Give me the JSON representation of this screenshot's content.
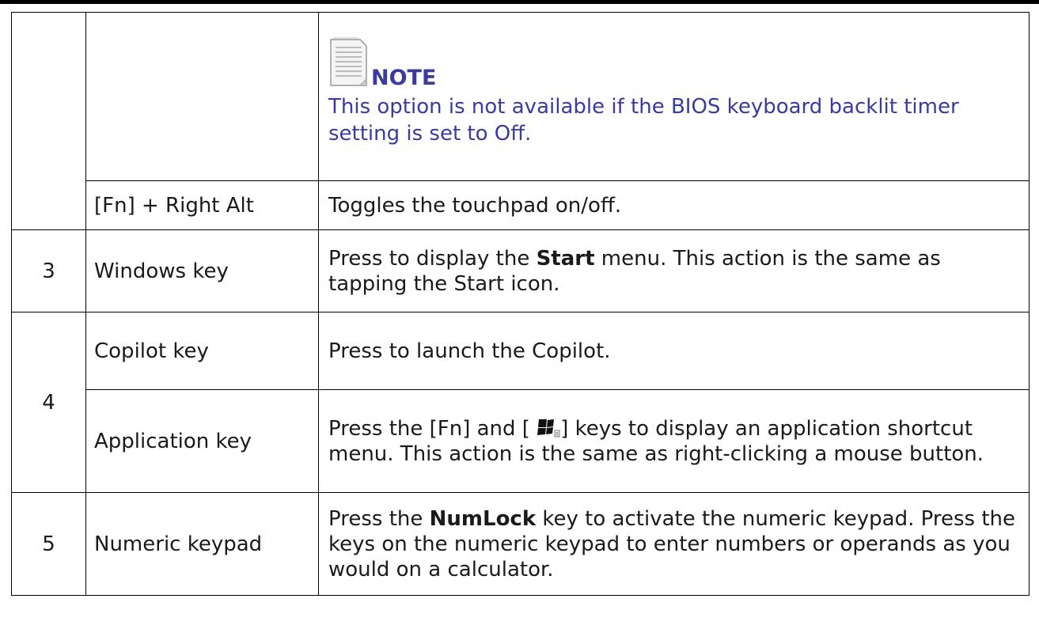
{
  "note": {
    "title": "NOTE",
    "text": "This option is not available if the BIOS keyboard backlit timer setting is set to Off."
  },
  "rows": [
    {
      "number": "",
      "key": "[Fn] + Right Alt",
      "description": "Toggles the touchpad on/off."
    },
    {
      "number": "3",
      "key": "Windows key",
      "description_parts": [
        "Press to display the ",
        "Start",
        " menu. This action is the same as tapping the Start icon."
      ]
    },
    {
      "number": "4",
      "key": "Copilot key",
      "description": "Press to launch the Copilot."
    },
    {
      "number": "",
      "key": "Application key",
      "description_parts": [
        "Press the [Fn] and [ ",
        "] keys to display an application shortcut menu. This action is the same as right-clicking a mouse button."
      ],
      "icon": "application-key-icon"
    },
    {
      "number": "5",
      "key": "Numeric keypad",
      "description_parts": [
        "Press the ",
        "NumLock",
        " key to activate the numeric keypad. Press the keys on the numeric keypad to enter numbers or operands as you would on a calculator."
      ]
    }
  ]
}
